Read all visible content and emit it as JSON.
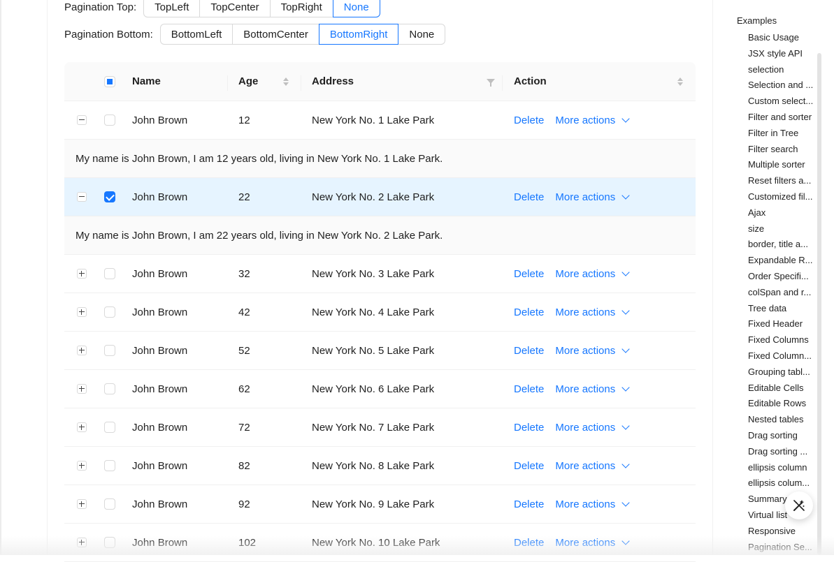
{
  "pagination_top": {
    "label": "Pagination Top",
    "options": [
      "TopLeft",
      "TopCenter",
      "TopRight",
      "None"
    ],
    "selected": "None"
  },
  "pagination_bottom": {
    "label": "Pagination Bottom",
    "options": [
      "BottomLeft",
      "BottomCenter",
      "BottomRight",
      "None"
    ],
    "selected": "BottomRight"
  },
  "table": {
    "columns": {
      "name": "Name",
      "age": "Age",
      "address": "Address",
      "action": "Action"
    },
    "delete_label": "Delete",
    "more_label": "More actions",
    "rows": [
      {
        "name": "John Brown",
        "age": "12",
        "address": "New York No. 1 Lake Park",
        "expanded": true,
        "checked": false,
        "description": "My name is John Brown, I am 12 years old, living in New York No. 1 Lake Park."
      },
      {
        "name": "John Brown",
        "age": "22",
        "address": "New York No. 2 Lake Park",
        "expanded": true,
        "checked": true,
        "description": "My name is John Brown, I am 22 years old, living in New York No. 2 Lake Park."
      },
      {
        "name": "John Brown",
        "age": "32",
        "address": "New York No. 3 Lake Park",
        "expanded": false,
        "checked": false
      },
      {
        "name": "John Brown",
        "age": "42",
        "address": "New York No. 4 Lake Park",
        "expanded": false,
        "checked": false
      },
      {
        "name": "John Brown",
        "age": "52",
        "address": "New York No. 5 Lake Park",
        "expanded": false,
        "checked": false
      },
      {
        "name": "John Brown",
        "age": "62",
        "address": "New York No. 6 Lake Park",
        "expanded": false,
        "checked": false
      },
      {
        "name": "John Brown",
        "age": "72",
        "address": "New York No. 7 Lake Park",
        "expanded": false,
        "checked": false
      },
      {
        "name": "John Brown",
        "age": "82",
        "address": "New York No. 8 Lake Park",
        "expanded": false,
        "checked": false
      },
      {
        "name": "John Brown",
        "age": "92",
        "address": "New York No. 9 Lake Park",
        "expanded": false,
        "checked": false
      },
      {
        "name": "John Brown",
        "age": "102",
        "address": "New York No. 10 Lake Park",
        "expanded": false,
        "checked": false
      }
    ]
  },
  "sidebar": {
    "title": "Examples",
    "items": [
      "Basic Usage",
      "JSX style API",
      "selection",
      "Selection and ...",
      "Custom select...",
      "Filter and sorter",
      "Filter in Tree",
      "Filter search",
      "Multiple sorter",
      "Reset filters a...",
      "Customized fil...",
      "Ajax",
      "size",
      "border, title a...",
      "Expandable R...",
      "Order Specifi...",
      "colSpan and r...",
      "Tree data",
      "Fixed Header",
      "Fixed Columns",
      "Fixed Column...",
      "Grouping tabl...",
      "Editable Cells",
      "Editable Rows",
      "Nested tables",
      "Drag sorting",
      "Drag sorting ...",
      "ellipsis column",
      "ellipsis colum...",
      "Summary",
      "Virtual list",
      "Responsive",
      "Pagination Se..."
    ]
  },
  "colors": {
    "primary": "#1677ff",
    "selected_row": "#e6f4ff",
    "header_bg": "#fafafa"
  },
  "icons": {
    "fab": "magic-wand-icon"
  }
}
